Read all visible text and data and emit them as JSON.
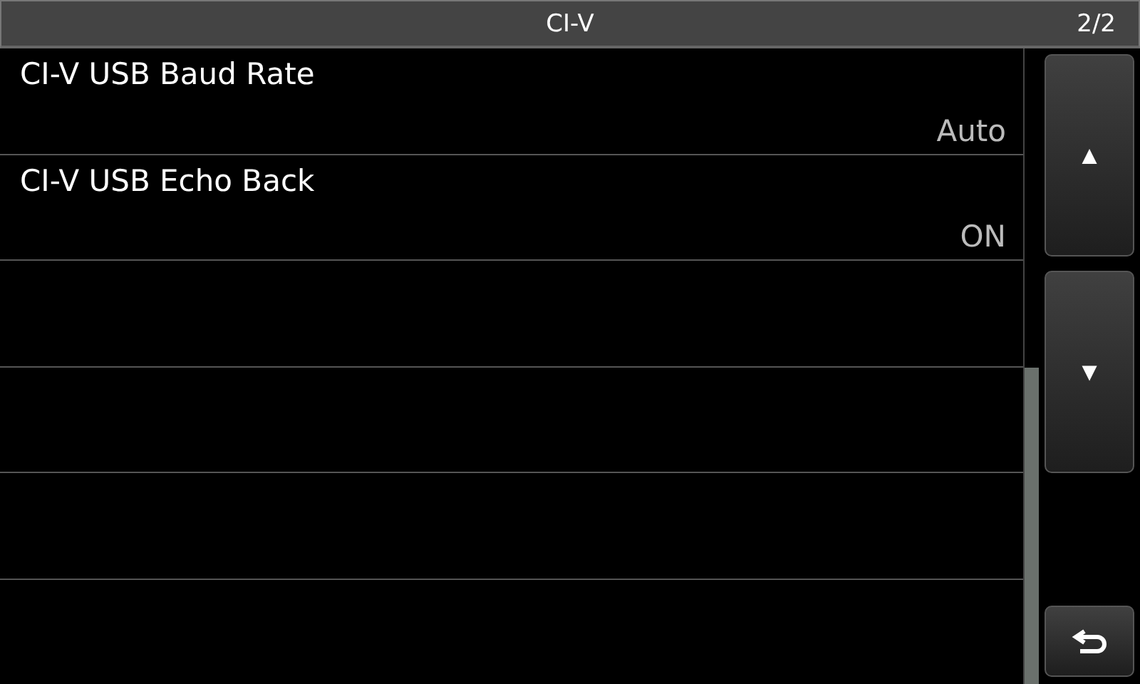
{
  "header": {
    "title": "CI-V",
    "page": "2/2"
  },
  "items": [
    {
      "label": "CI-V USB Baud Rate",
      "value": "Auto"
    },
    {
      "label": "CI-V USB Echo Back",
      "value": "ON"
    }
  ],
  "buttons": {
    "up": "▲",
    "down": "▼"
  }
}
